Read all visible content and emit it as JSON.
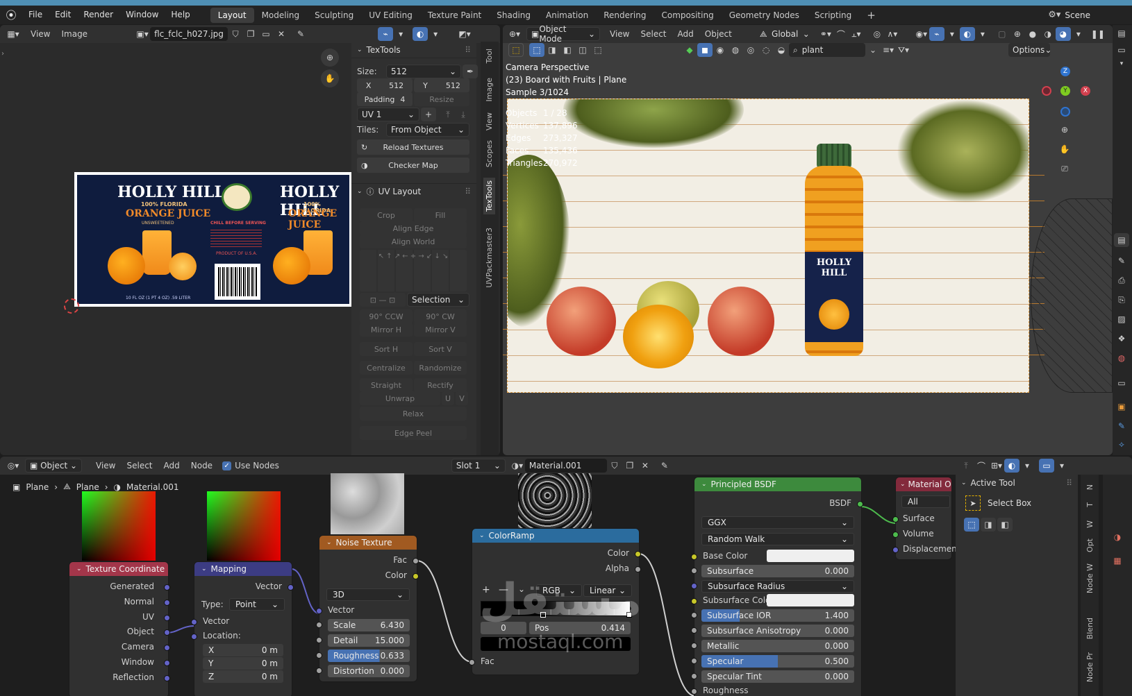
{
  "menu": {
    "items": [
      "File",
      "Edit",
      "Render",
      "Window",
      "Help"
    ],
    "workspaces": [
      "Layout",
      "Modeling",
      "Sculpting",
      "UV Editing",
      "Texture Paint",
      "Shading",
      "Animation",
      "Rendering",
      "Compositing",
      "Geometry Nodes",
      "Scripting"
    ],
    "active_workspace": "Layout",
    "scene": "Scene"
  },
  "image_editor": {
    "view": "View",
    "image": "Image",
    "filename": "flc_fclc_h027.jpg",
    "label": {
      "brand": "HOLLY HILL",
      "sub": "100% FLORIDA",
      "product": "ORANGE JUICE",
      "unsweetened": "UNSWEETENED",
      "volume": "10 FL OZ (1 PT 4 OZ) .59 LITER",
      "chill": "CHILL BEFORE SERVING",
      "origin": "PRODUCT OF U.S.A."
    }
  },
  "textools": {
    "title": "TexTools",
    "size_label": "Size:",
    "size_value": "512",
    "x_label": "X",
    "x_value": "512",
    "y_label": "Y",
    "y_value": "512",
    "padding_label": "Padding",
    "padding_value": "4",
    "resize": "Resize",
    "uv_map": "UV 1",
    "tiles_label": "Tiles:",
    "tiles_value": "From Object",
    "reload": "Reload Textures",
    "checker": "Checker Map",
    "uv_layout": "UV Layout",
    "crop": "Crop",
    "fill": "Fill",
    "align_edge": "Align Edge",
    "align_world": "Align World",
    "selection": "Selection",
    "ccw": "90° CCW",
    "cw": "90° CW",
    "mirror_h": "Mirror H",
    "mirror_v": "Mirror V",
    "sort_h": "Sort H",
    "sort_v": "Sort V",
    "centralize": "Centralize",
    "randomize": "Randomize",
    "straight": "Straight",
    "rectify": "Rectify",
    "unwrap": "Unwrap",
    "u": "U",
    "v": "V",
    "relax": "Relax",
    "edge_peel": "Edge Peel",
    "tabs": [
      "Tool",
      "Image",
      "View",
      "Scopes",
      "TexTools",
      "UVPackmaster3"
    ]
  },
  "viewport": {
    "mode": "Object Mode",
    "menus": [
      "View",
      "Select",
      "Add",
      "Object"
    ],
    "transform": "Global",
    "search": "plant",
    "options": "Options",
    "camera": "Camera Perspective",
    "object_info": "(23) Board with Fruits | Plane",
    "sample": "Sample 3/1024",
    "stats": [
      {
        "k": "Objects",
        "v": "1 / 28"
      },
      {
        "k": "Vertices",
        "v": "137,896"
      },
      {
        "k": "Edges",
        "v": "273,327"
      },
      {
        "k": "Faces",
        "v": "135,436"
      },
      {
        "k": "Triangles",
        "v": "270,972"
      }
    ],
    "bottle_label": "HOLLY HILL"
  },
  "node_editor": {
    "type": "Object",
    "menus": [
      "View",
      "Select",
      "Add",
      "Node"
    ],
    "use_nodes": "Use Nodes",
    "slot": "Slot 1",
    "material": "Material.001",
    "breadcrumb": [
      "Plane",
      "Plane",
      "Material.001"
    ],
    "texcoord": {
      "title": "Texture Coordinate",
      "outputs": [
        "Generated",
        "Normal",
        "UV",
        "Object",
        "Camera",
        "Window",
        "Reflection"
      ]
    },
    "mapping": {
      "title": "Mapping",
      "out": "Vector",
      "type_label": "Type:",
      "type": "Point",
      "vector": "Vector",
      "location": "Location:",
      "x": "X",
      "y": "Y",
      "z": "Z",
      "xv": "0 m",
      "yv": "0 m",
      "zv": "0 m"
    },
    "noise": {
      "title": "Noise Texture",
      "fac": "Fac",
      "color": "Color",
      "dim": "3D",
      "vector": "Vector",
      "scale_l": "Scale",
      "scale": "6.430",
      "detail_l": "Detail",
      "detail": "15.000",
      "rough_l": "Roughness",
      "rough": "0.633",
      "dist_l": "Distortion",
      "dist": "0.000"
    },
    "colorramp": {
      "title": "ColorRamp",
      "color": "Color",
      "alpha": "Alpha",
      "mode": "RGB",
      "interp": "Linear",
      "index": "0",
      "pos_l": "Pos",
      "pos": "0.414",
      "fac": "Fac"
    },
    "bsdf": {
      "title": "Principled BSDF",
      "out": "BSDF",
      "dist": "GGX",
      "sss_method": "Random Walk",
      "rows": [
        {
          "label": "Base Color",
          "type": "color"
        },
        {
          "label": "Subsurface",
          "value": "0.000"
        },
        {
          "label": "Subsurface Radius",
          "type": "dd"
        },
        {
          "label": "Subsurface Color",
          "type": "color"
        },
        {
          "label": "Subsurface IOR",
          "value": "1.400",
          "fill": 0.25
        },
        {
          "label": "Subsurface Anisotropy",
          "value": "0.000"
        },
        {
          "label": "Metallic",
          "value": "0.000"
        },
        {
          "label": "Specular",
          "value": "0.500",
          "fill": 0.5
        },
        {
          "label": "Specular Tint",
          "value": "0.000"
        },
        {
          "label": "Roughness",
          "value": ""
        }
      ]
    },
    "output": {
      "title": "Material Ou",
      "target": "All",
      "sockets": [
        "Surface",
        "Volume",
        "Displacement"
      ]
    },
    "active_tool": {
      "title": "Active Tool",
      "tool": "Select Box"
    },
    "side_tabs": [
      "N",
      "T",
      "W",
      "Opt",
      "Node W",
      "Blend",
      "Node Pr"
    ]
  },
  "watermark": {
    "arabic": "مستقل",
    "latin": "mostaql.com"
  },
  "colors": {
    "accent": "#4772b3",
    "header_input": "#a3364a",
    "header_vector": "#3c3c83",
    "header_texture": "#a15a21",
    "header_converter": "#2b6c9e",
    "header_shader": "#3d8a3d",
    "header_output": "#832a3c"
  }
}
